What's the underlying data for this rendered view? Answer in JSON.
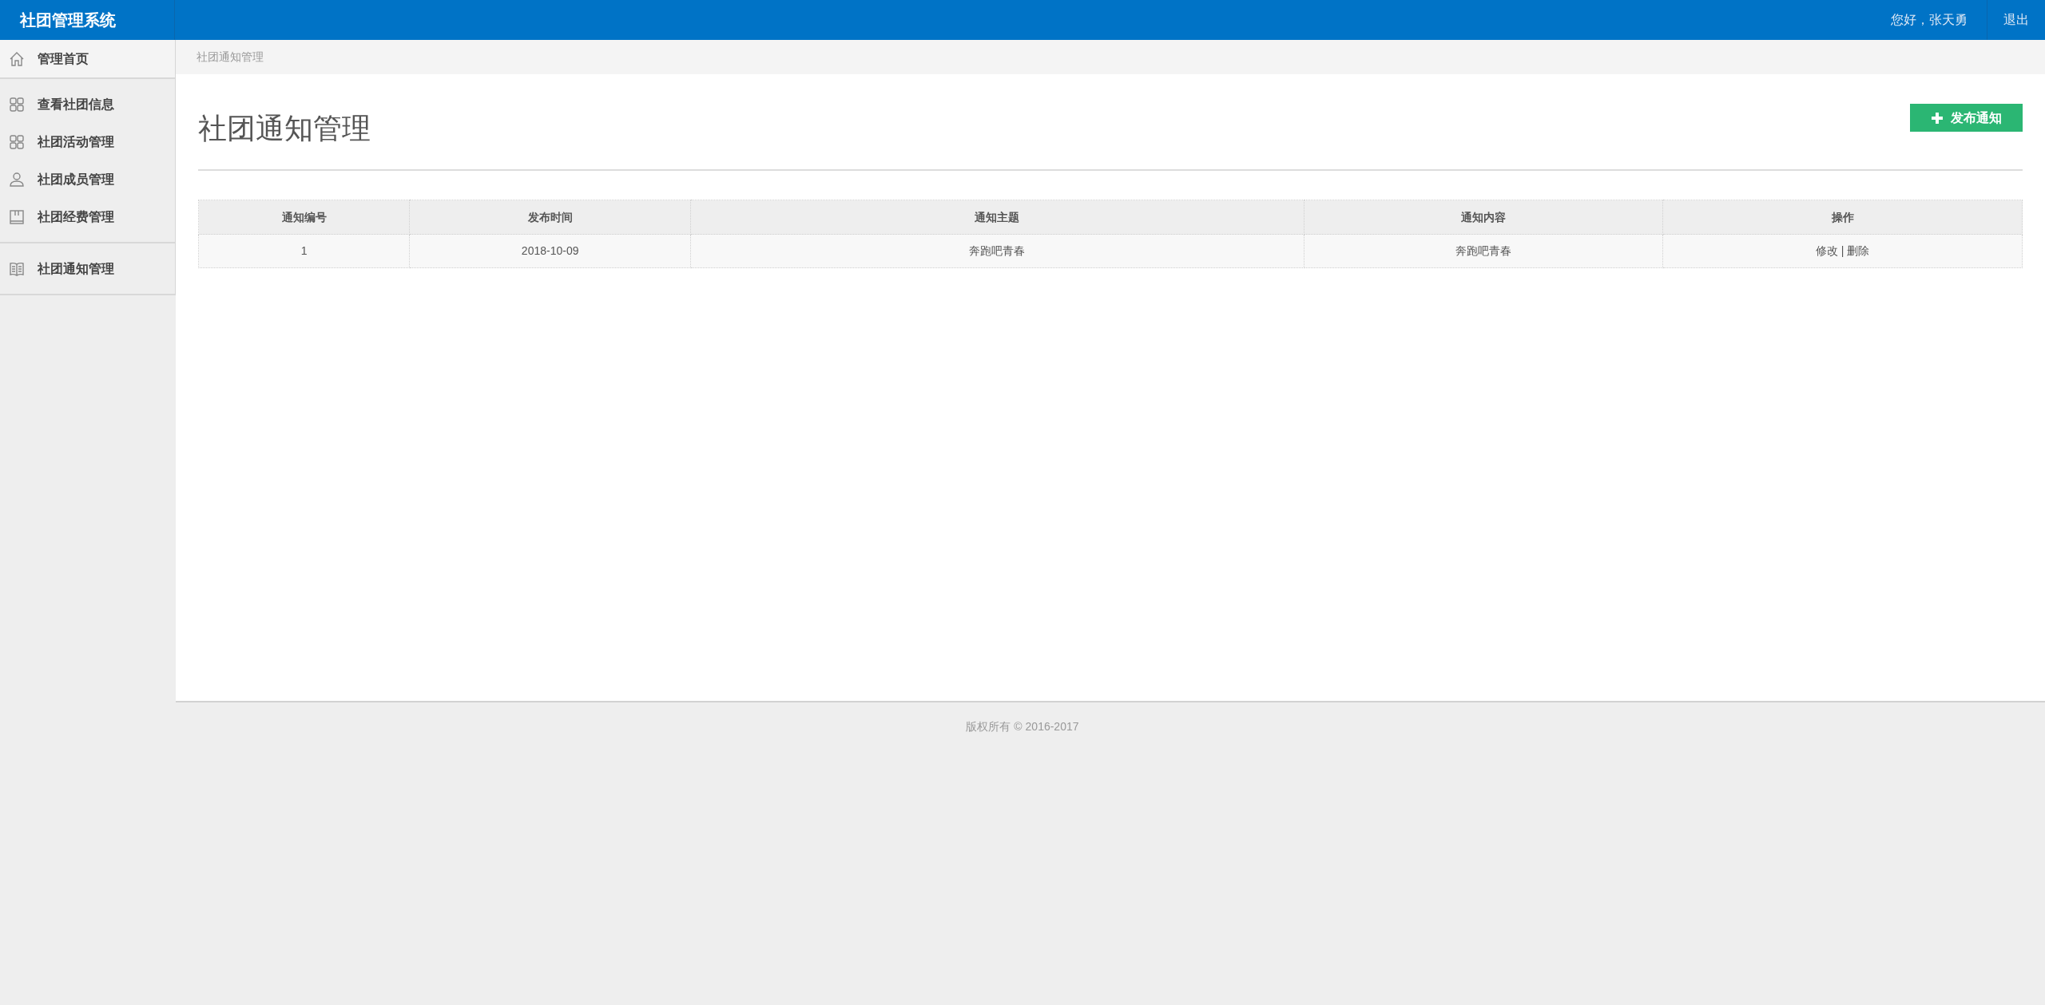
{
  "header": {
    "title": "社团管理系统",
    "greeting": "您好，张天勇",
    "logout": "退出"
  },
  "sidebar": {
    "groups": [
      {
        "items": [
          "管理首页"
        ]
      },
      {
        "items": [
          "查看社团信息",
          "社团活动管理",
          "社团成员管理",
          "社团经费管理"
        ]
      },
      {
        "items": [
          "社团通知管理"
        ]
      }
    ]
  },
  "breadcrumb": "社团通知管理",
  "page_title": "社团通知管理",
  "add_button": "发布通知",
  "table": {
    "columns": [
      "通知编号",
      "发布时间",
      "通知主题",
      "通知内容",
      "操作"
    ],
    "rows": [
      {
        "cells": [
          "1",
          "2018-10-09",
          "奔跑吧青春",
          "奔跑吧青春"
        ],
        "actions": [
          "修改",
          "删除"
        ]
      }
    ],
    "action_separator": "|"
  },
  "footer": "版权所有 © 2016-2017"
}
